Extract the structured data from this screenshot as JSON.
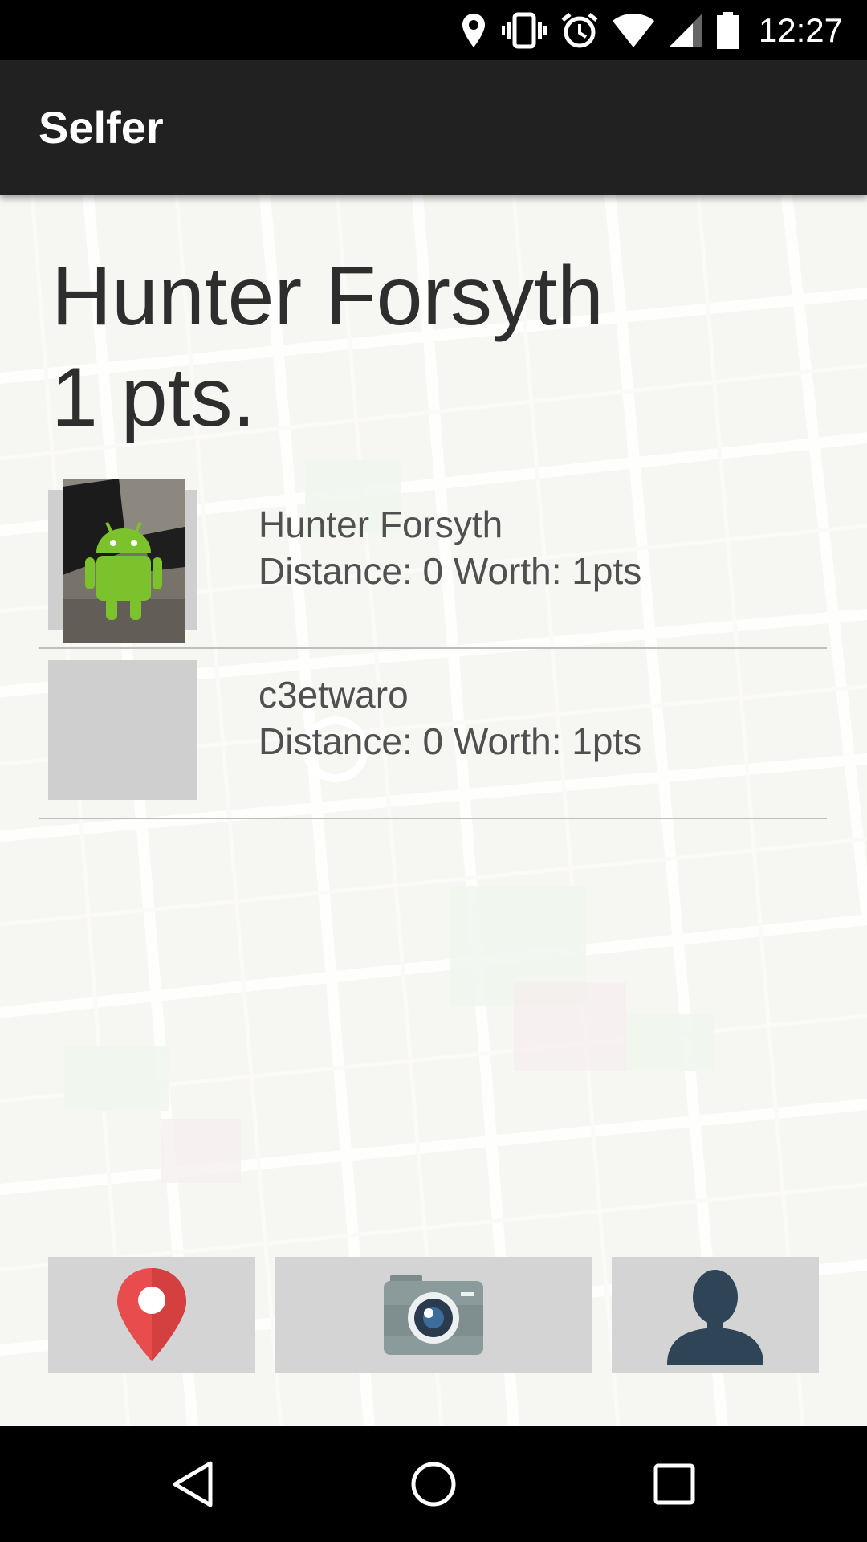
{
  "status_bar": {
    "time": "12:27",
    "icons": [
      "location-icon",
      "vibrate-icon",
      "alarm-icon",
      "wifi-icon",
      "cell-signal-icon",
      "battery-icon"
    ]
  },
  "app_bar": {
    "title": "Selfer"
  },
  "profile": {
    "name": "Hunter Forsyth",
    "points": "1 pts."
  },
  "leaderboard": [
    {
      "name": "Hunter Forsyth",
      "meta": "Distance: 0 Worth: 1pts",
      "has_photo": true
    },
    {
      "name": "c3etwaro",
      "meta": "Distance: 0 Worth: 1pts",
      "has_photo": false
    }
  ],
  "actions": [
    "map-pin-icon",
    "camera-icon",
    "profile-icon"
  ],
  "nav": [
    "back-icon",
    "home-icon",
    "recents-icon"
  ],
  "colors": {
    "status_bar": "#000000",
    "app_bar": "#212121",
    "pin": "#e84c4c",
    "profile_icon": "#2f4557",
    "camera_body": "#8b9a9b"
  }
}
